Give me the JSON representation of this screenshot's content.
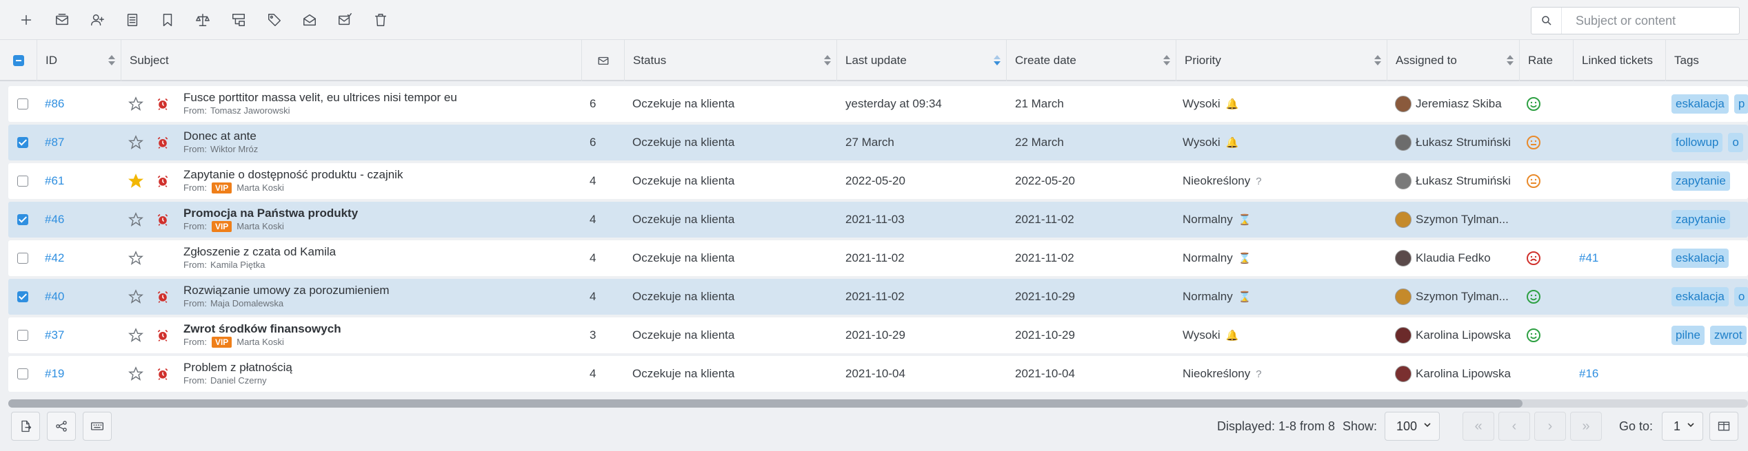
{
  "toolbar": {
    "icons": [
      "plus-icon",
      "merge-icon",
      "assign-user-icon",
      "notes-icon",
      "bookmark-icon",
      "scales-icon",
      "hierarchy-icon",
      "tag-icon",
      "mail-open-icon",
      "mail-check-icon",
      "trash-icon"
    ]
  },
  "search": {
    "placeholder": "Subject or content"
  },
  "columns": {
    "id": "ID",
    "subject": "Subject",
    "status": "Status",
    "last_update": "Last update",
    "create_date": "Create date",
    "priority": "Priority",
    "assigned_to": "Assigned to",
    "rate": "Rate",
    "linked": "Linked tickets",
    "tags": "Tags"
  },
  "rows": [
    {
      "id": "#86",
      "selected": false,
      "starred": false,
      "alarm": true,
      "subject": "Fusce porttitor massa velit, eu ultrices nisi tempor eu",
      "bold": false,
      "vip": false,
      "from_label": "From:",
      "from": "Tomasz Jaworowski",
      "messages": "6",
      "status": "Oczekuje na klienta",
      "last_update": "yesterday at 09:34",
      "create_date": "21 March",
      "priority": "Wysoki",
      "priority_icon": "🔔",
      "assigned": "Jeremiasz Skiba",
      "rate": "happy",
      "linked": "",
      "tags": [
        "eskalacja",
        "p"
      ]
    },
    {
      "id": "#87",
      "selected": true,
      "starred": false,
      "alarm": true,
      "subject": "Donec at ante",
      "bold": false,
      "vip": false,
      "from_label": "From:",
      "from": "Wiktor Mróz",
      "messages": "6",
      "status": "Oczekuje na klienta",
      "last_update": "27 March",
      "create_date": "22 March",
      "priority": "Wysoki",
      "priority_icon": "🔔",
      "assigned": "Łukasz Strumiński",
      "rate": "neutral",
      "linked": "",
      "tags": [
        "followup",
        "o"
      ]
    },
    {
      "id": "#61",
      "selected": false,
      "starred": true,
      "alarm": true,
      "subject": "Zapytanie o dostępność produktu - czajnik",
      "bold": false,
      "vip": true,
      "vip_label": "VIP",
      "from_label": "From:",
      "from": "Marta Koski",
      "messages": "4",
      "status": "Oczekuje na klienta",
      "last_update": "2022-05-20",
      "create_date": "2022-05-20",
      "priority": "Nieokreślony",
      "priority_icon": "?",
      "assigned": "Łukasz Strumiński",
      "rate": "neutral",
      "linked": "",
      "tags": [
        "zapytanie"
      ]
    },
    {
      "id": "#46",
      "selected": true,
      "starred": false,
      "alarm": true,
      "subject": "Promocja na Państwa produkty",
      "bold": true,
      "vip": true,
      "vip_label": "VIP",
      "from_label": "From:",
      "from": "Marta Koski",
      "messages": "4",
      "status": "Oczekuje na klienta",
      "last_update": "2021-11-03",
      "create_date": "2021-11-02",
      "priority": "Normalny",
      "priority_icon": "⌛",
      "assigned": "Szymon Tylman...",
      "rate": "",
      "linked": "",
      "tags": [
        "zapytanie"
      ]
    },
    {
      "id": "#42",
      "selected": false,
      "starred": false,
      "alarm": false,
      "subject": "Zgłoszenie z czata od Kamila",
      "bold": false,
      "vip": false,
      "from_label": "From:",
      "from": "Kamila Piętka",
      "messages": "4",
      "status": "Oczekuje na klienta",
      "last_update": "2021-11-02",
      "create_date": "2021-11-02",
      "priority": "Normalny",
      "priority_icon": "⌛",
      "assigned": "Klaudia Fedko",
      "rate": "sad",
      "linked": "#41",
      "tags": [
        "eskalacja"
      ]
    },
    {
      "id": "#40",
      "selected": true,
      "starred": false,
      "alarm": true,
      "subject": "Rozwiązanie umowy za porozumieniem",
      "bold": false,
      "vip": false,
      "from_label": "From:",
      "from": "Maja Domalewska",
      "messages": "4",
      "status": "Oczekuje na klienta",
      "last_update": "2021-11-02",
      "create_date": "2021-10-29",
      "priority": "Normalny",
      "priority_icon": "⌛",
      "assigned": "Szymon Tylman...",
      "rate": "happy",
      "linked": "",
      "tags": [
        "eskalacja",
        "o"
      ]
    },
    {
      "id": "#37",
      "selected": false,
      "starred": false,
      "alarm": true,
      "subject": "Zwrot środków finansowych",
      "bold": true,
      "vip": true,
      "vip_label": "VIP",
      "from_label": "From:",
      "from": "Marta Koski",
      "messages": "3",
      "status": "Oczekuje na klienta",
      "last_update": "2021-10-29",
      "create_date": "2021-10-29",
      "priority": "Wysoki",
      "priority_icon": "🔔",
      "assigned": "Karolina Lipowska",
      "rate": "happy",
      "linked": "",
      "tags": [
        "pilne",
        "zwrot"
      ]
    },
    {
      "id": "#19",
      "selected": false,
      "starred": false,
      "alarm": true,
      "subject": "Problem z płatnością",
      "bold": false,
      "vip": false,
      "from_label": "From:",
      "from": "Daniel Czerny",
      "messages": "4",
      "status": "Oczekuje na klienta",
      "last_update": "2021-10-04",
      "create_date": "2021-10-04",
      "priority": "Nieokreślony",
      "priority_icon": "?",
      "assigned": "Karolina Lipowska",
      "rate": "",
      "linked": "#16",
      "tags": []
    }
  ],
  "footer": {
    "displayed": "Displayed: 1-8 from 8",
    "show_label": "Show:",
    "show_value": "100",
    "goto_label": "Go to:",
    "goto_value": "1",
    "pager": [
      "«",
      "‹",
      "›",
      "»"
    ]
  },
  "colors": {
    "accent": "#2f8fe0",
    "selected_row": "#d5e4f1",
    "tag_bg": "#b9dcf5",
    "vip": "#ef7f1a",
    "alarm": "#d0312d",
    "star": "#f2b705"
  }
}
